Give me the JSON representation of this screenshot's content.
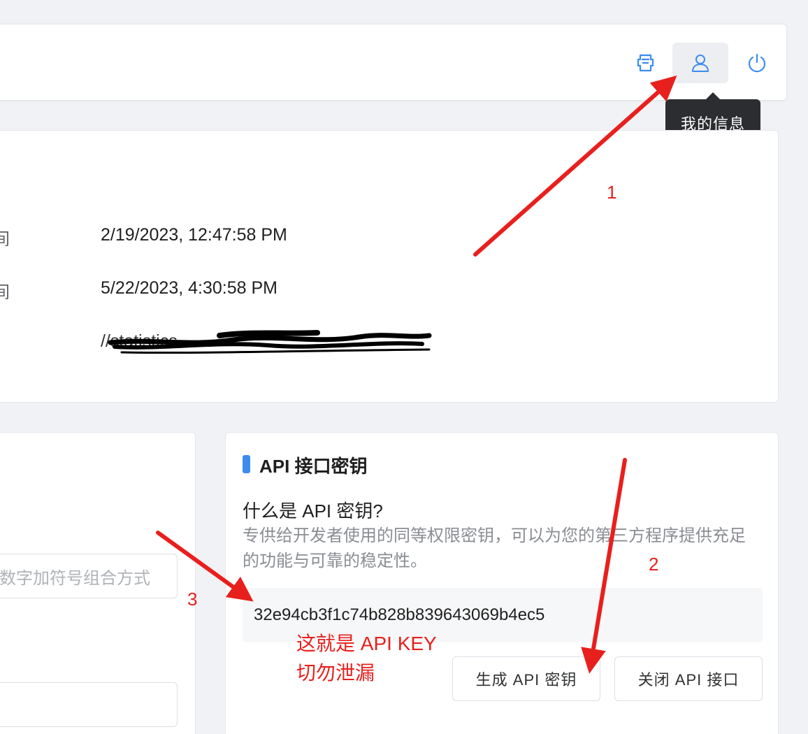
{
  "header": {
    "icons": [
      {
        "name": "screenshot-icon",
        "color": "#3c8cf0"
      },
      {
        "name": "user-icon",
        "color": "#3c8cf0",
        "active": true
      },
      {
        "name": "power-icon",
        "color": "#3c8cf0"
      }
    ],
    "tooltip": "我的信息"
  },
  "info": {
    "rows": [
      {
        "label": "间",
        "value": "2/19/2023, 12:47:58 PM"
      },
      {
        "label": "间",
        "value": "5/22/2023, 4:30:58 PM"
      },
      {
        "label": "",
        "value": "//statistics"
      }
    ]
  },
  "left_panel": {
    "password_placeholder": "数字加符号组合方式"
  },
  "api": {
    "title": "API 接口密钥",
    "question": "什么是 API 密钥?",
    "description": "专供给开发者使用的同等权限密钥，可以为您的第三方程序提供充足的功能与可靠的稳定性。",
    "key": "32e94cb3f1c74b828b839643069b4ec5",
    "generate_button": "生成 API 密钥",
    "close_button": "关闭 API 接口"
  },
  "annotations": {
    "step1": "1",
    "step2": "2",
    "step3": "3",
    "note_line1": "这就是 API KEY",
    "note_line2": "切勿泄漏",
    "color": "#e8201d"
  }
}
